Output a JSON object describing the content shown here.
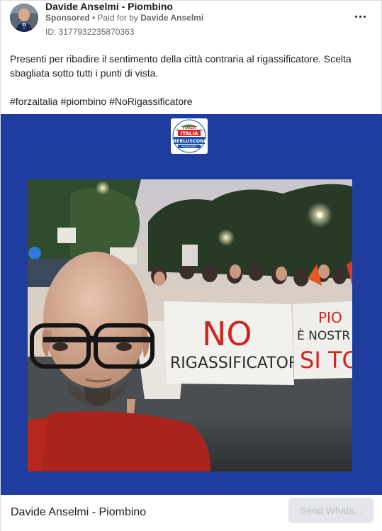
{
  "post": {
    "page_name": "Davide Anselmi - Piombino",
    "sponsored_label": "Sponsored",
    "paid_for_prefix": " • Paid for by ",
    "payer_name": "Davide Anselmi",
    "ad_id": "ID: 3177932235870363",
    "more_icon": "ellipsis-icon",
    "body_line_1": "Presenti per ribadire il sentimento della città contraria al rigassificatore. Scelta sbagliata sotto tutti i punti di vista.",
    "hashtags": "#forzaitalia #piombino #NoRigassificatore"
  },
  "media": {
    "background_color": "#1f3d9e",
    "logo": {
      "text_top": "FORZA",
      "text_mid": "ITALIA",
      "text_name": "BERLUSCONI",
      "text_sub": "PRESIDENTE"
    },
    "banner_1_line_1": "NO",
    "banner_1_line_2": "RIGASSIFICATORE",
    "banner_2_line_1": "PIO",
    "banner_2_line_2": "È NOSTR",
    "banner_2_line_3": "SI TO"
  },
  "footer": {
    "page_name": "Davide Anselmi - Piombino",
    "cta_label": "Send Whats..."
  }
}
